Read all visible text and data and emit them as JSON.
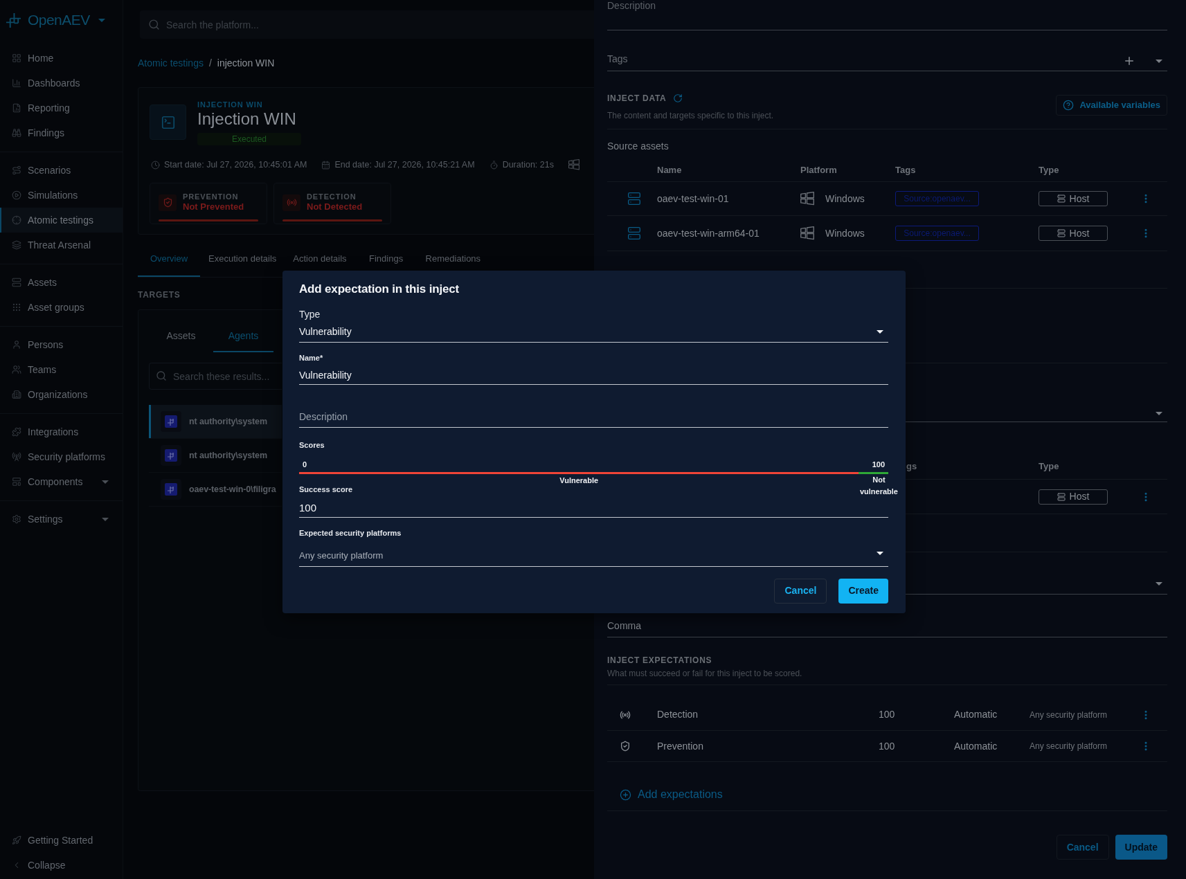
{
  "sidebar": {
    "brand": "OpenAEV",
    "groups": [
      {
        "items": [
          {
            "label": "Home",
            "selected": false,
            "expandable": false
          },
          {
            "label": "Dashboards",
            "selected": false,
            "expandable": false
          },
          {
            "label": "Reporting",
            "selected": false,
            "expandable": false
          },
          {
            "label": "Findings",
            "selected": false,
            "expandable": false
          }
        ]
      },
      {
        "items": [
          {
            "label": "Scenarios",
            "selected": false,
            "expandable": false
          },
          {
            "label": "Simulations",
            "selected": false,
            "expandable": false
          },
          {
            "label": "Atomic testings",
            "selected": true,
            "expandable": false
          },
          {
            "label": "Threat Arsenal",
            "selected": false,
            "expandable": false
          }
        ]
      },
      {
        "items": [
          {
            "label": "Assets",
            "selected": false,
            "expandable": false
          },
          {
            "label": "Asset groups",
            "selected": false,
            "expandable": false
          }
        ]
      },
      {
        "items": [
          {
            "label": "Persons",
            "selected": false,
            "expandable": false
          },
          {
            "label": "Teams",
            "selected": false,
            "expandable": false
          },
          {
            "label": "Organizations",
            "selected": false,
            "expandable": false
          }
        ]
      },
      {
        "items": [
          {
            "label": "Integrations",
            "selected": false,
            "expandable": false
          },
          {
            "label": "Security platforms",
            "selected": false,
            "expandable": false
          },
          {
            "label": "Components",
            "selected": false,
            "expandable": true
          }
        ]
      },
      {
        "items": [
          {
            "label": "Settings",
            "selected": false,
            "expandable": true
          }
        ]
      }
    ],
    "footer": [
      {
        "label": "Getting Started"
      },
      {
        "label": "Collapse"
      }
    ]
  },
  "topbar": {
    "search": {
      "placeholder": "Search the platform..."
    }
  },
  "breadcrumb": {
    "separator": "/",
    "items": [
      {
        "label": "Atomic testings",
        "kind": "link"
      },
      {
        "label": "injection WIN",
        "kind": "current"
      }
    ]
  },
  "header": {
    "overline": "INJECTION WIN",
    "title": "Injection WIN",
    "status": "Executed",
    "dates": [
      "Start date: Jul 27, 2026, 10:45:01 AM",
      "End date: Jul 27, 2026, 10:45:21 AM",
      "Duration: 21s"
    ],
    "results": [
      {
        "kind": "prevention",
        "label": "PREVENTION",
        "value": "Not Prevented"
      },
      {
        "kind": "detection",
        "label": "DETECTION",
        "value": "Not Detected"
      }
    ]
  },
  "tabs": [
    {
      "label": "Overview",
      "selected": true
    },
    {
      "label": "Execution details",
      "selected": false
    },
    {
      "label": "Action details",
      "selected": false
    },
    {
      "label": "Findings",
      "selected": false
    },
    {
      "label": "Remediations",
      "selected": false
    }
  ],
  "targets": {
    "title": "TARGETS",
    "tabs": [
      {
        "label": "Assets",
        "selected": false
      },
      {
        "label": "Agents",
        "selected": true
      }
    ],
    "search": {
      "placeholder": "Search these results..."
    },
    "rows": [
      {
        "name": "nt authority\\system",
        "selected": true
      },
      {
        "name": "nt authority\\system",
        "selected": false
      },
      {
        "name": "oaev-test-win-0\\filigra",
        "selected": false
      }
    ]
  },
  "drawer": {
    "description": {
      "placeholder": "Description"
    },
    "tags": {
      "placeholder": "Tags"
    },
    "inject_data": {
      "title": "INJECT DATA",
      "subtitle": "The content and targets specific to this inject.",
      "variables_button": "Available variables"
    },
    "source_assets": {
      "title": "Source assets",
      "columns": [
        "Name",
        "Platform",
        "Tags",
        "Type"
      ],
      "rows": [
        {
          "name": "oaev-test-win-01",
          "platform": "Windows",
          "tag": "Source:openaev...",
          "type": "Host"
        },
        {
          "name": "oaev-test-win-arm64-01",
          "platform": "Windows",
          "tag": "Source:openaev...",
          "type": "Host"
        }
      ]
    },
    "second_table": {
      "columns": [
        "gs",
        "Type"
      ],
      "rows": [
        {
          "type": "Host"
        }
      ]
    },
    "select_field": {
      "value": "Comma"
    },
    "expectations": {
      "title": "INJECT EXPECTATIONS",
      "subtitle": "What must succeed or fail for this inject to be scored.",
      "rows": [
        {
          "kind": "detection",
          "name": "Detection",
          "score": "100",
          "mode": "Automatic",
          "platform": "Any security platform"
        },
        {
          "kind": "prevention",
          "name": "Prevention",
          "score": "100",
          "mode": "Automatic",
          "platform": "Any security platform"
        }
      ],
      "add_label": "Add expectations"
    },
    "buttons": [
      {
        "label": "Cancel",
        "kind": "secondary"
      },
      {
        "label": "Update",
        "kind": "primary"
      }
    ]
  },
  "dialog": {
    "title": "Add expectation in this inject",
    "type": {
      "label": "Type",
      "value": "Vulnerability"
    },
    "name": {
      "label": "Name*",
      "value": "Vulnerability"
    },
    "description": {
      "placeholder": "Description"
    },
    "scores": {
      "label": "Scores",
      "min": "0",
      "max": "100",
      "level": 0.95,
      "low_label": "Vulnerable",
      "high_label": "Not vulnerable"
    },
    "success_score": {
      "label": "Success score",
      "value": "100"
    },
    "platforms": {
      "label": "Expected security platforms",
      "placeholder": "Any security platform"
    },
    "buttons": [
      {
        "label": "Cancel",
        "kind": "secondary"
      },
      {
        "label": "Create",
        "kind": "primary"
      }
    ]
  }
}
